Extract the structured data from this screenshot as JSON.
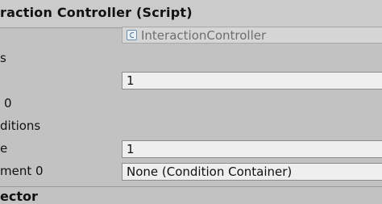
{
  "component": {
    "title": "raction Controller (Script)",
    "script_value": "InteractionController"
  },
  "rows": {
    "label_s": "s",
    "size_value": "1",
    "label_0": "0",
    "label_ditions": "ditions",
    "label_e": "e",
    "size2_value": "1",
    "label_element0": "ment 0",
    "element0_value": "None (Condition Container)"
  },
  "next_component": {
    "title": "ector"
  }
}
